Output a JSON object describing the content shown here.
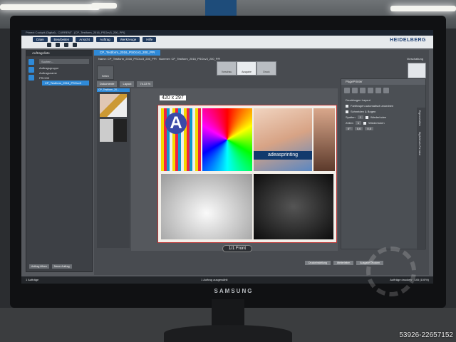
{
  "window": {
    "title": "Prinect Cockpit (Digital) - CURRENT - [CP_Testform_2016_PSOcv3_200_PPI]"
  },
  "menu": [
    "Datei",
    "Bearbeiten",
    "Ansicht",
    "Auftrag",
    "Werkzeuge",
    "Hilfe"
  ],
  "brand": {
    "logo": "HEIDELBERG",
    "monitor": "SAMSUNG"
  },
  "left_panel": {
    "title": "Auftragsliste",
    "search_placeholder": "Suchen...",
    "group_label": "Auftragsgruppe",
    "section_label": "Auftragsname",
    "folder_label": "PRJ193",
    "selected_item": "CP_Testform_2016_PSOcv3",
    "buttons": [
      "Auftrag öffnen",
      "Neuer Auftrag"
    ]
  },
  "job": {
    "tab": "CP_Testform_2016_PSOcv3_200_PPI",
    "name_label": "Name",
    "name_value": "CP_Testform_2016_PSOcv3_200_PPI",
    "number_label": "Nummer",
    "number_value": "CP_Testform_2016_PSOcv3_200_PPI",
    "pdf_label": "Vorschaltung",
    "steps": [
      "Vorschau",
      "Ausgabe",
      "Druck"
    ],
    "view_button": "Seiten",
    "right_button": "Ausgabe",
    "controls": [
      "Dokumente",
      "Layout",
      "74.33 %"
    ],
    "thumb_label": "CP_Testform_20..."
  },
  "canvas": {
    "dimension": "420 x 297",
    "front_label": "1/1 Front",
    "brand_strip": "adeasprinting"
  },
  "right_panel": {
    "title": "PagePrinter",
    "section": "Druckbogen Layout",
    "option1": "Farbtragen automatisch anordnen",
    "option2": "Schneiden & Bogen",
    "rows_label": "Spalten",
    "rows_value": "1",
    "cols_label": "Zeilen",
    "cols_value": "1",
    "repeat1": "Wiederholen",
    "repeat2": "Wiederholen",
    "offset_x": "0°",
    "offset_a": "0,0",
    "offset_b": "0,0",
    "side_tabs": [
      "Eigenschaften",
      "Digitaldruck-Formular"
    ]
  },
  "bottom_buttons": [
    "Druckeinstellung",
    "Weiterleiten",
    "Ausgabe Drucken"
  ],
  "status": {
    "left": "1 Aufträge",
    "center": "1 Auftrag ausgewählt",
    "right": "Aufträge drucken · 145 (100%)"
  },
  "watermark": "53926-22657152",
  "colors": {
    "accent": "#2f8ad8",
    "menu": "#203a5e",
    "logo": "#1d3f73"
  }
}
